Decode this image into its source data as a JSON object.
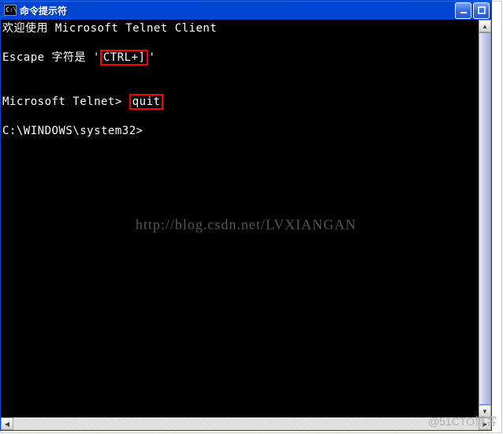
{
  "titlebar": {
    "icon_text": "C:\\",
    "title": "命令提示符"
  },
  "terminal": {
    "line1": "欢迎使用 Microsoft Telnet Client",
    "line2_prefix": "Escape 字符是 '",
    "line2_highlight": "CTRL+]",
    "line2_suffix": "'",
    "line3_prompt": "Microsoft Telnet> ",
    "line3_highlight": "quit",
    "line4": "C:\\WINDOWS\\system32>"
  },
  "watermarks": {
    "center": "http://blog.csdn.net/LVXIANGAN",
    "corner": "@51CTO博客"
  },
  "scrollbar": {
    "up": "▲",
    "down": "▼",
    "left": "◀",
    "right": "▶"
  }
}
